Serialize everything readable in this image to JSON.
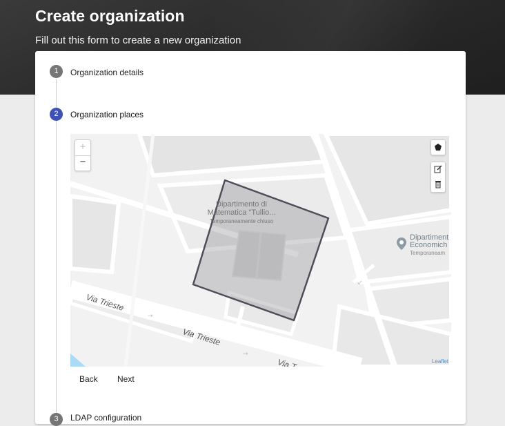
{
  "header": {
    "title": "Create organization",
    "subtitle": "Fill out this form to create a new organization"
  },
  "stepper": {
    "steps": [
      {
        "number": "1",
        "label": "Organization details",
        "state": "completed"
      },
      {
        "number": "2",
        "label": "Organization places",
        "state": "active"
      },
      {
        "number": "3",
        "label": "LDAP configuration",
        "state": "pending"
      }
    ],
    "colors": {
      "active": "#3f51b5",
      "inactive": "#757575"
    }
  },
  "map": {
    "zoom_in": "+",
    "zoom_out": "−",
    "building_label_line1": "Dipartimento di",
    "building_label_line2": "Matematica \"Tullio...",
    "building_label_line3": "Temporaneamente chiuso",
    "poi_label_line1": "Dipartiment",
    "poi_label_line2": "Economich",
    "poi_label_line3": "Temporaneam",
    "street_1": "Via Trieste",
    "street_2": "Via Trieste",
    "street_3": "Via T",
    "attribution": "Leaflet",
    "tools": [
      "polygon-icon",
      "edit-icon",
      "delete-icon"
    ]
  },
  "actions": {
    "back_label": "Back",
    "next_label": "Next"
  }
}
